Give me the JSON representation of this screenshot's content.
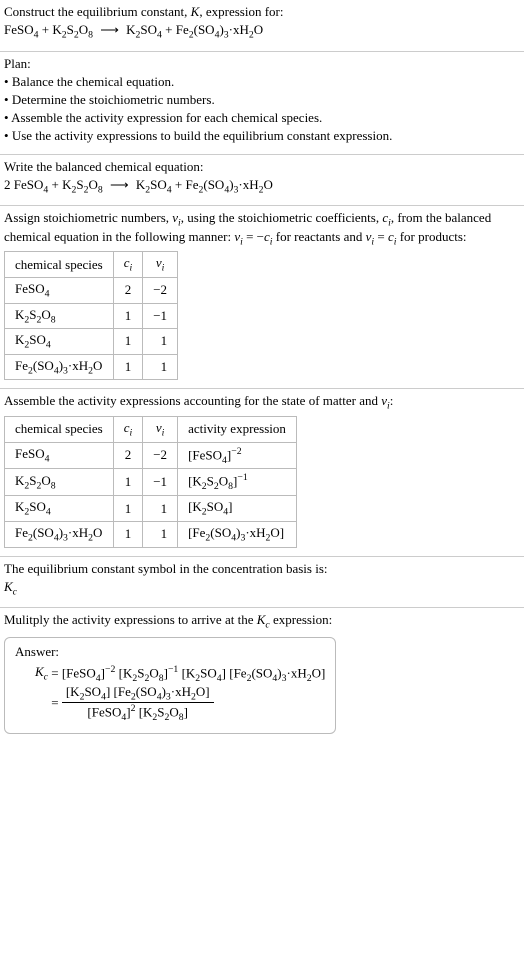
{
  "intro": {
    "line1": "Construct the equilibrium constant, K, expression for:",
    "equation": "FeSO₄ + K₂S₂O₈ ⟶ K₂SO₄ + Fe₂(SO₄)₃·xH₂O"
  },
  "plan": {
    "heading": "Plan:",
    "items": [
      "Balance the chemical equation.",
      "Determine the stoichiometric numbers.",
      "Assemble the activity expression for each chemical species.",
      "Use the activity expressions to build the equilibrium constant expression."
    ]
  },
  "balanced": {
    "heading": "Write the balanced chemical equation:",
    "equation": "2 FeSO₄ + K₂S₂O₈ ⟶ K₂SO₄ + Fe₂(SO₄)₃·xH₂O"
  },
  "stoich": {
    "heading_part1": "Assign stoichiometric numbers, ",
    "heading_part2": ", using the stoichiometric coefficients, ",
    "heading_part3": ", from the balanced chemical equation in the following manner: ",
    "heading_part4": " for reactants and ",
    "heading_part5": " for products:",
    "headers": {
      "species": "chemical species",
      "c": "cᵢ",
      "v": "νᵢ"
    },
    "rows": [
      {
        "species": "FeSO₄",
        "c": "2",
        "v": "−2"
      },
      {
        "species": "K₂S₂O₈",
        "c": "1",
        "v": "−1"
      },
      {
        "species": "K₂SO₄",
        "c": "1",
        "v": "1"
      },
      {
        "species": "Fe₂(SO₄)₃·xH₂O",
        "c": "1",
        "v": "1"
      }
    ]
  },
  "activity": {
    "heading": "Assemble the activity expressions accounting for the state of matter and νᵢ:",
    "headers": {
      "species": "chemical species",
      "c": "cᵢ",
      "v": "νᵢ",
      "act": "activity expression"
    },
    "rows": [
      {
        "species": "FeSO₄",
        "c": "2",
        "v": "−2",
        "act": "[FeSO₄]⁻²"
      },
      {
        "species": "K₂S₂O₈",
        "c": "1",
        "v": "−1",
        "act": "[K₂S₂O₈]⁻¹"
      },
      {
        "species": "K₂SO₄",
        "c": "1",
        "v": "1",
        "act": "[K₂SO₄]"
      },
      {
        "species": "Fe₂(SO₄)₃·xH₂O",
        "c": "1",
        "v": "1",
        "act": "[Fe₂(SO₄)₃·xH₂O]"
      }
    ]
  },
  "symbol": {
    "line1": "The equilibrium constant symbol in the concentration basis is:",
    "value": "K_c"
  },
  "final": {
    "heading": "Mulitply the activity expressions to arrive at the K_c expression:",
    "answer_label": "Answer:",
    "kc": "K_c",
    "rhs1": "[FeSO₄]⁻² [K₂S₂O₈]⁻¹ [K₂SO₄] [Fe₂(SO₄)₃·xH₂O]",
    "frac_num": "[K₂SO₄] [Fe₂(SO₄)₃·xH₂O]",
    "frac_den": "[FeSO₄]² [K₂S₂O₈]"
  }
}
